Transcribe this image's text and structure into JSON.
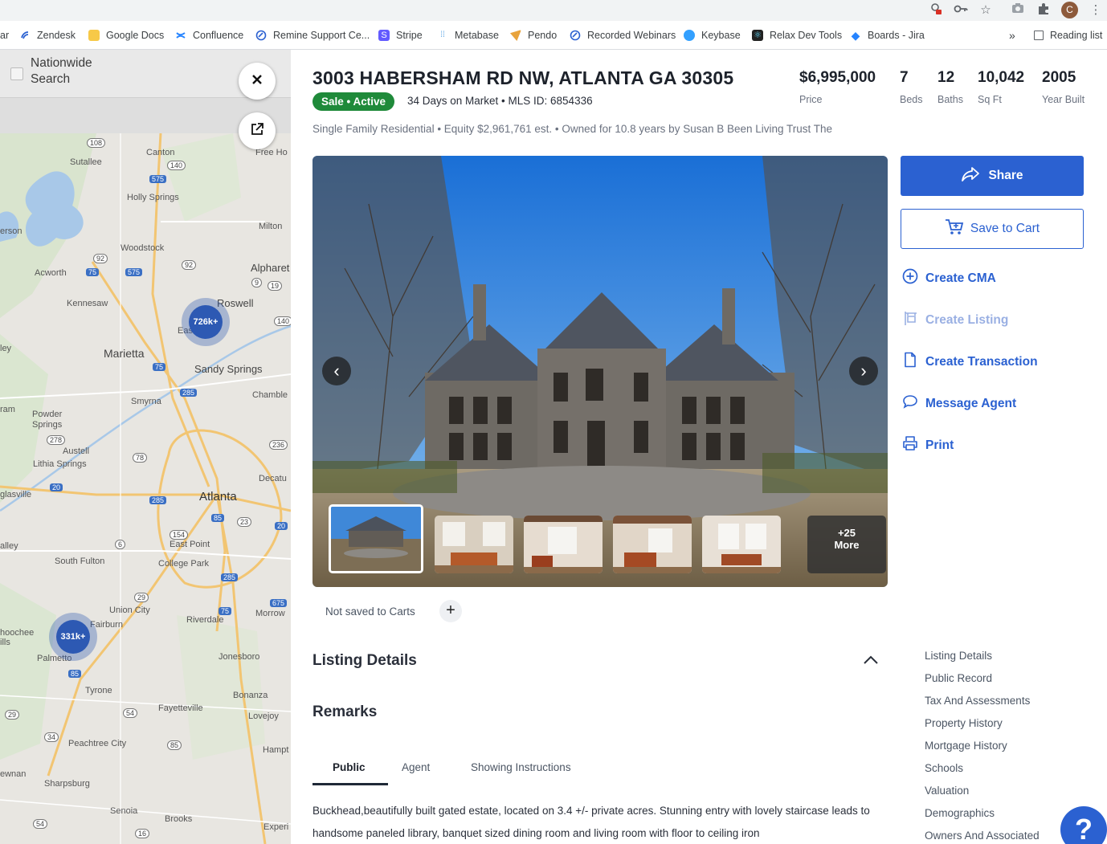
{
  "browser": {
    "profile_initial": "C",
    "bookmarks": [
      {
        "label": "ar",
        "icon": "none"
      },
      {
        "label": "Zendesk",
        "icon": "zendesk-icon"
      },
      {
        "label": "Google Docs",
        "icon": "folder-icon"
      },
      {
        "label": "Confluence",
        "icon": "confluence-icon"
      },
      {
        "label": "Remine Support Ce...",
        "icon": "remine-icon"
      },
      {
        "label": "Stripe",
        "icon": "stripe-icon"
      },
      {
        "label": "Metabase",
        "icon": "metabase-icon"
      },
      {
        "label": "Pendo",
        "icon": "pendo-icon"
      },
      {
        "label": "Recorded Webinars",
        "icon": "remine-icon"
      },
      {
        "label": "Keybase",
        "icon": "keybase-icon"
      },
      {
        "label": "Relax Dev Tools",
        "icon": "react-icon"
      },
      {
        "label": "Boards - Jira",
        "icon": "jira-icon"
      }
    ],
    "overflow": "»",
    "reading_list": "Reading list"
  },
  "map": {
    "nationwide_search": "Nationwide Search",
    "places": [
      "Canton",
      "Sutallee",
      "Holly Springs",
      "Free Ho",
      "Milton",
      "Woodstock",
      "Alpharet",
      "Acworth",
      "Kennesaw",
      "Roswell",
      "East",
      "Marietta",
      "Sandy Springs",
      "Chamble",
      "Smyrna",
      "Powder Springs",
      "Austell",
      "Lithia Springs",
      "Decatu",
      "glasville",
      "Atlanta",
      "East Point",
      "alley",
      "South Fulton",
      "College Park",
      "Union City",
      "Morrow",
      "Fairburn",
      "Riverdale",
      "hoochee",
      "ills",
      "Palmetto",
      "Jonesboro",
      "Tyrone",
      "Bonanza",
      "Fayetteville",
      "Lovejoy",
      "Peachtree City",
      "Hampt",
      "ewnan",
      "Sharpsburg",
      "Senoia",
      "Brooks",
      "Experi",
      "erson",
      "ley",
      "ram"
    ],
    "route_numbers": [
      "108",
      "140",
      "575",
      "92",
      "75",
      "575",
      "92",
      "9",
      "19",
      "140",
      "75",
      "285",
      "236",
      "278",
      "78",
      "20",
      "285",
      "85",
      "23",
      "20",
      "154",
      "6",
      "285",
      "29",
      "675",
      "75",
      "85",
      "54",
      "34",
      "85",
      "29",
      "16",
      "54"
    ],
    "clusters": [
      {
        "label": "726k+"
      },
      {
        "label": "331k+"
      }
    ]
  },
  "listing": {
    "address": "3003 HABERSHAM RD NW, ATLANTA GA 30305",
    "status": "Sale • Active",
    "days_mls": "34 Days on Market • MLS ID: 6854336",
    "subline": "Single Family Residential • Equity $2,961,761 est. • Owned for 10.8 years by Susan B Been Living Trust The",
    "stats": [
      {
        "value": "$6,995,000",
        "label": "Price"
      },
      {
        "value": "7",
        "label": "Beds"
      },
      {
        "value": "12",
        "label": "Baths"
      },
      {
        "value": "10,042",
        "label": "Sq Ft"
      },
      {
        "value": "2005",
        "label": "Year Built"
      }
    ],
    "more_photos": "+25",
    "more_label": "More",
    "carts_status": "Not saved to Carts"
  },
  "actions": {
    "share": "Share",
    "save_to_cart": "Save to Cart",
    "create_cma": "Create CMA",
    "create_listing": "Create Listing",
    "create_transaction": "Create Transaction",
    "message_agent": "Message Agent",
    "print": "Print"
  },
  "sections": {
    "listing_details": "Listing Details",
    "remarks": "Remarks",
    "tabs": [
      "Public",
      "Agent",
      "Showing Instructions"
    ],
    "remarks_text": "Buckhead,beautifully built gated estate, located on 3.4 +/- private acres. Stunning entry with lovely staircase leads to handsome paneled library, banquet sized dining room and living room with floor to ceiling iron"
  },
  "toc": [
    "Listing Details",
    "Public Record",
    "Tax And Assessments",
    "Property History",
    "Mortgage History",
    "Schools",
    "Valuation",
    "Demographics",
    "Owners And Associated"
  ],
  "help": "?",
  "colors": {
    "primary": "#2b61d1",
    "status_green": "#1f8a3a",
    "cluster_blue": "#2d59b3"
  }
}
